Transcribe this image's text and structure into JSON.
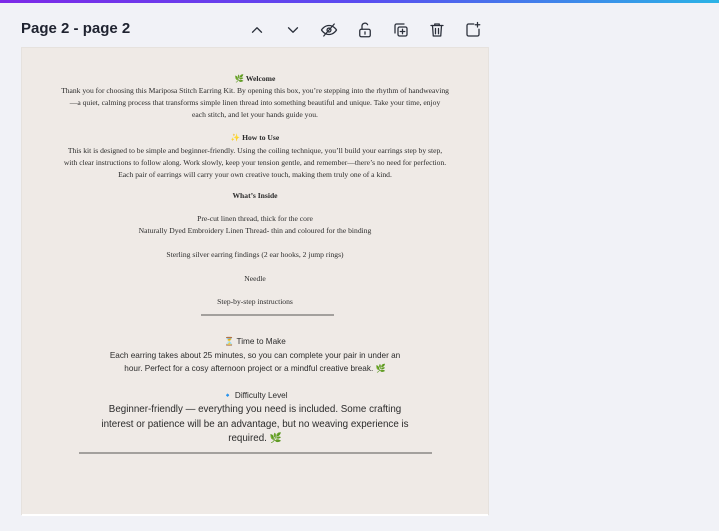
{
  "page": {
    "title": "Page 2 - page 2"
  },
  "toolbar": {
    "buttons": [
      {
        "name": "move-up",
        "icon": "chevron-up-icon"
      },
      {
        "name": "move-down",
        "icon": "chevron-down-icon"
      },
      {
        "name": "hide-page",
        "icon": "eye-slash-icon"
      },
      {
        "name": "lock-page",
        "icon": "lock-open-icon"
      },
      {
        "name": "duplicate-page",
        "icon": "duplicate-icon"
      },
      {
        "name": "delete-page",
        "icon": "trash-icon"
      },
      {
        "name": "add-page",
        "icon": "add-page-icon"
      }
    ]
  },
  "doc": {
    "welcome": {
      "heading": "🌿 Welcome",
      "lines": [
        "Thank you for choosing this Mariposa Stitch Earring Kit. By opening this box, you’re stepping into the rhythm of handweaving",
        "—a quiet, calming process that transforms simple linen thread into something beautiful and unique. Take your time, enjoy",
        "each stitch, and let your hands guide you."
      ]
    },
    "how_to_use": {
      "heading": "✨ How to Use",
      "lines": [
        "This kit is designed to be simple and beginner-friendly. Using the coiling technique, you’ll build your earrings step by step,",
        "with clear instructions to follow along. Work slowly, keep your tension gentle, and remember—there’s no need for perfection.",
        "Each pair of earrings will carry your own creative touch, making them truly one of a kind."
      ]
    },
    "whats_inside": {
      "heading": "What’s Inside",
      "items": [
        "Pre-cut linen thread, thick for the core",
        "Naturally Dyed Embroidery Linen Thread- thin and coloured for the binding",
        "Sterling silver earring findings (2 ear hooks, 2 jump rings)",
        "Needle",
        "Step-by-step instructions"
      ]
    },
    "time_to_make": {
      "heading": "⏳ Time to Make",
      "lines": [
        "Each earring takes about 25 minutes, so you can complete your pair in under an",
        "hour. Perfect for a cosy afternoon project or a mindful creative break. 🌿"
      ]
    },
    "difficulty": {
      "heading": "🔹 Difficulty Level",
      "lines": [
        "Beginner-friendly — everything you need is included. Some crafting",
        "interest or patience will be an advantage, but no weaving experience is",
        "required. 🌿"
      ]
    }
  }
}
